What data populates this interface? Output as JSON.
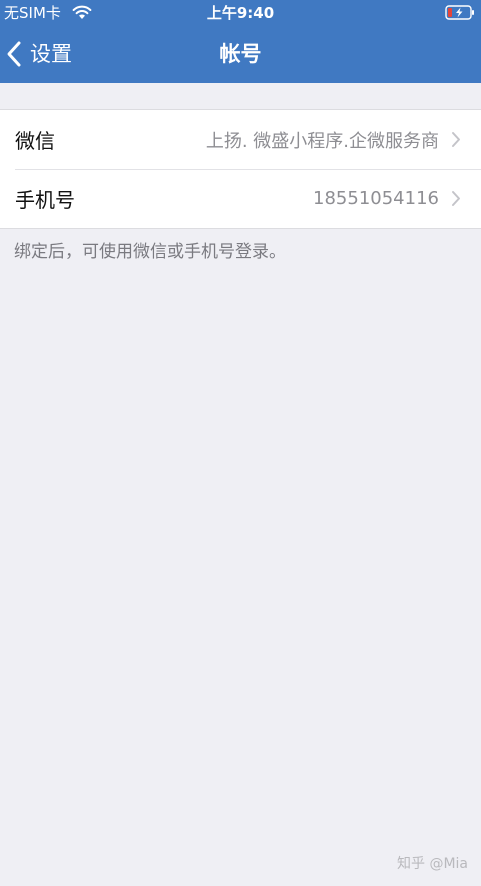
{
  "status_bar": {
    "carrier": "无SIM卡",
    "time": "上午9:40",
    "wifi_icon": "wifi-icon",
    "battery_icon": "battery-charging-icon"
  },
  "nav": {
    "back_label": "设置",
    "back_icon": "chevron-left-icon",
    "title": "帐号"
  },
  "rows": [
    {
      "label": "微信",
      "value": "上扬. 微盛小程序.企微服务商",
      "icon": "chevron-right-icon"
    },
    {
      "label": "手机号",
      "value": "18551054116",
      "icon": "chevron-right-icon"
    }
  ],
  "hint": "绑定后，可使用微信或手机号登录。",
  "watermark": "知乎 @Mia",
  "colors": {
    "header_bg": "#4079c2",
    "page_bg": "#efeff4",
    "battery_bolt": "#e5453a"
  }
}
